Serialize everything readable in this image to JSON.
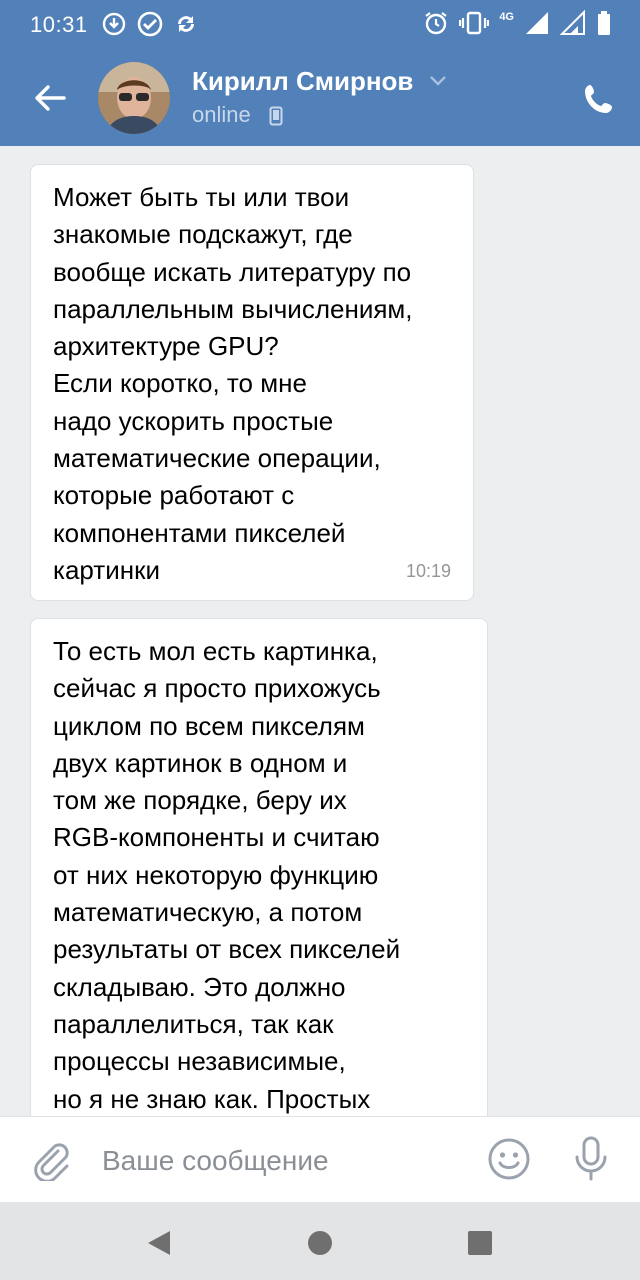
{
  "status_bar": {
    "time": "10:31",
    "network": "4G",
    "icons": [
      "download-icon",
      "check-circle-icon",
      "sync-icon",
      "alarm-icon",
      "vibrate-icon",
      "signal-icon",
      "battery-icon"
    ]
  },
  "header": {
    "contact_name": "Кирилл Смирнов",
    "presence": "online",
    "accent": "#5181b8"
  },
  "messages": [
    {
      "text": "Может быть ты или твои\nзнакомые подскажут, где\nвообще искать литературу по\nпараллельным вычислениям,\nархитектуре GPU?\nЕсли коротко, то мне\nнадо ускорить простые\nматематические операции,\nкоторые работают с\nкомпонентами пикселей\nкартинки",
      "time": "10:19"
    },
    {
      "text": "То есть мол есть картинка,\nсейчас я просто прихожусь\nциклом по всем пикселям\nдвух картинок в одном и\nтом же порядке, беру их\nRGB-компоненты и считаю\nот них некоторую функцию\nматематическую, а потом\nрезультаты от всех пикселей\nскладываю. Это должно\nпараллелиться, так как\nпроцессы независимые,\nно я не знаю как. Простых",
      "time": ""
    }
  ],
  "composer": {
    "placeholder": "Ваше сообщение"
  }
}
